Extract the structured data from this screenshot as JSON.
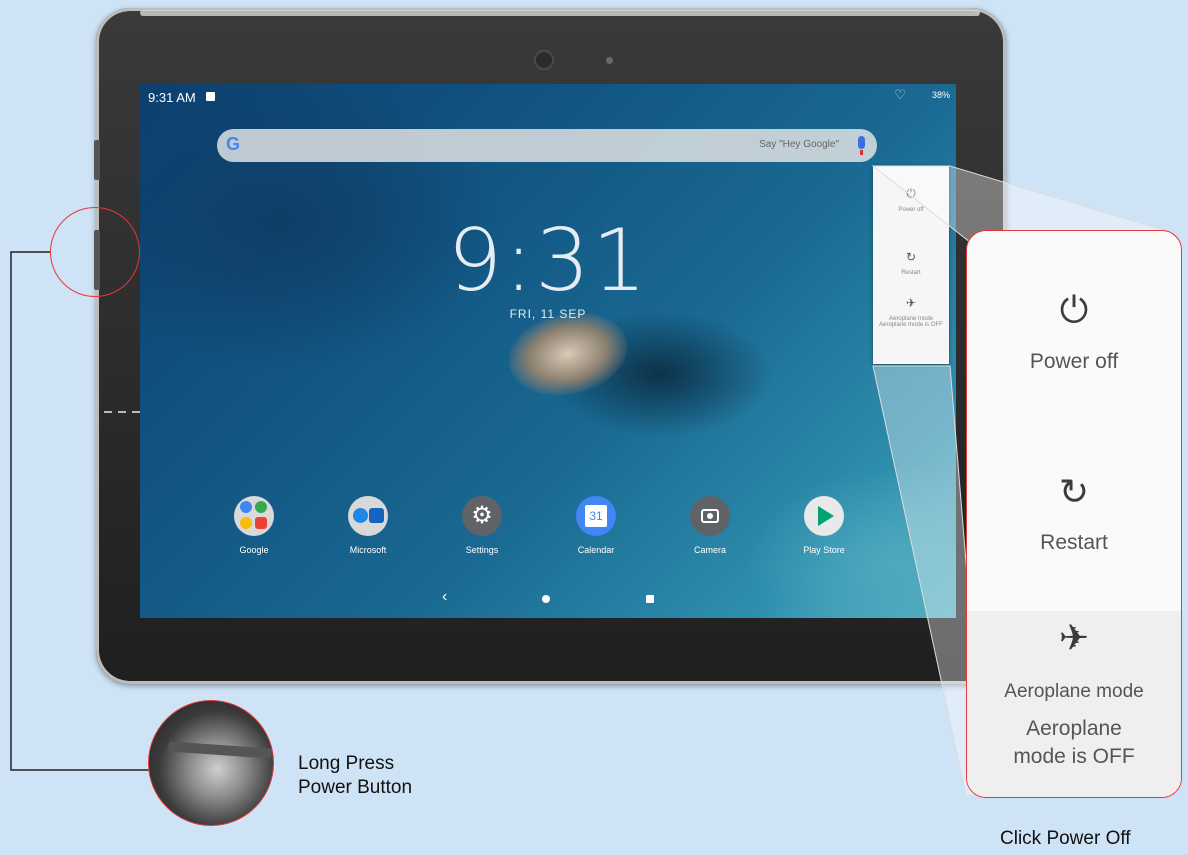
{
  "status_bar": {
    "time": "9:31 AM",
    "battery": "38%"
  },
  "search": {
    "google_letter": "G",
    "hint": "Say \"Hey Google\""
  },
  "lock_clock": {
    "time": "9:31",
    "date": "FRI, 11 SEP"
  },
  "dock_apps": [
    {
      "label": "Google",
      "icon": "google-folder-icon"
    },
    {
      "label": "Microsoft",
      "icon": "microsoft-folder-icon"
    },
    {
      "label": "Settings",
      "icon": "gear-icon"
    },
    {
      "label": "Calendar",
      "icon": "calendar-icon",
      "badge": "31"
    },
    {
      "label": "Camera",
      "icon": "camera-icon"
    },
    {
      "label": "Play Store",
      "icon": "play-store-icon"
    }
  ],
  "nav_bar": {
    "back_glyph": "‹"
  },
  "power_menu": {
    "items": [
      {
        "label": "Power off",
        "icon": "power-icon",
        "glyph": "⏻"
      },
      {
        "label": "Restart",
        "icon": "restart-icon",
        "glyph": "↻"
      },
      {
        "label": "Aeroplane mode",
        "sublabel": "Aeroplane mode is OFF",
        "icon": "airplane-icon",
        "glyph": "✈"
      }
    ]
  },
  "captions": {
    "long_press_line1": "Long Press",
    "long_press_line2": "Power Button",
    "click_power_off": "Click Power Off"
  },
  "colors": {
    "callout_red": "#e53935",
    "background": "#cfe3f6"
  }
}
